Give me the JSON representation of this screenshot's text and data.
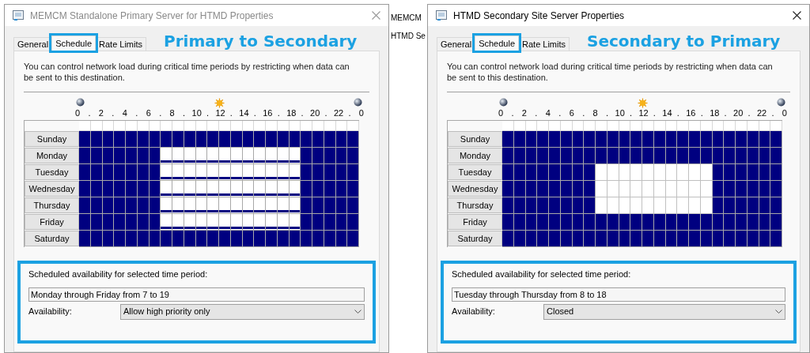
{
  "background_list": {
    "items": [
      "MEMCM",
      "HTMD Se"
    ]
  },
  "windows": [
    {
      "title": "MEMCM Standalone Primary Server for HTMD Properties",
      "active": false,
      "tabs": [
        {
          "label": "General",
          "selected": false,
          "highlight": false
        },
        {
          "label": "Schedule",
          "selected": true,
          "highlight": true
        },
        {
          "label": "Rate Limits",
          "selected": false,
          "highlight": false
        }
      ],
      "annotation": "Primary to Secondary",
      "description": "You can control network load during critical time periods by restricting when data can be sent to this destination.",
      "hours": [
        "0",
        ".",
        "2",
        ".",
        "4",
        ".",
        "6",
        ".",
        "8",
        ".",
        "10",
        ".",
        "12",
        ".",
        "14",
        ".",
        "16",
        ".",
        "18",
        ".",
        "20",
        ".",
        "22",
        ".",
        "0"
      ],
      "days": [
        {
          "label": "Sunday",
          "slots": [
            {
              "kind": "open"
            },
            {
              "kind": "open"
            },
            {
              "kind": "open"
            },
            {
              "kind": "open"
            },
            {
              "kind": "open"
            },
            {
              "kind": "open"
            },
            {
              "kind": "open"
            },
            {
              "kind": "open"
            },
            {
              "kind": "open"
            },
            {
              "kind": "open"
            },
            {
              "kind": "open"
            },
            {
              "kind": "open"
            },
            {
              "kind": "open"
            },
            {
              "kind": "open"
            },
            {
              "kind": "open"
            },
            {
              "kind": "open"
            },
            {
              "kind": "open"
            },
            {
              "kind": "open"
            },
            {
              "kind": "open"
            },
            {
              "kind": "open"
            },
            {
              "kind": "open"
            },
            {
              "kind": "open"
            },
            {
              "kind": "open"
            },
            {
              "kind": "open"
            }
          ]
        },
        {
          "label": "Monday",
          "slots": [
            {
              "kind": "open"
            },
            {
              "kind": "open"
            },
            {
              "kind": "open"
            },
            {
              "kind": "open"
            },
            {
              "kind": "open"
            },
            {
              "kind": "open"
            },
            {
              "kind": "open"
            },
            {
              "kind": "high"
            },
            {
              "kind": "high"
            },
            {
              "kind": "high"
            },
            {
              "kind": "high"
            },
            {
              "kind": "high"
            },
            {
              "kind": "high"
            },
            {
              "kind": "high"
            },
            {
              "kind": "high"
            },
            {
              "kind": "high"
            },
            {
              "kind": "high"
            },
            {
              "kind": "high"
            },
            {
              "kind": "high"
            },
            {
              "kind": "open"
            },
            {
              "kind": "open"
            },
            {
              "kind": "open"
            },
            {
              "kind": "open"
            },
            {
              "kind": "open"
            }
          ]
        },
        {
          "label": "Tuesday",
          "slots": [
            {
              "kind": "open"
            },
            {
              "kind": "open"
            },
            {
              "kind": "open"
            },
            {
              "kind": "open"
            },
            {
              "kind": "open"
            },
            {
              "kind": "open"
            },
            {
              "kind": "open"
            },
            {
              "kind": "high"
            },
            {
              "kind": "high"
            },
            {
              "kind": "high"
            },
            {
              "kind": "high"
            },
            {
              "kind": "high"
            },
            {
              "kind": "high"
            },
            {
              "kind": "high"
            },
            {
              "kind": "high"
            },
            {
              "kind": "high"
            },
            {
              "kind": "high"
            },
            {
              "kind": "high"
            },
            {
              "kind": "high"
            },
            {
              "kind": "open"
            },
            {
              "kind": "open"
            },
            {
              "kind": "open"
            },
            {
              "kind": "open"
            },
            {
              "kind": "open"
            }
          ]
        },
        {
          "label": "Wednesday",
          "slots": [
            {
              "kind": "open"
            },
            {
              "kind": "open"
            },
            {
              "kind": "open"
            },
            {
              "kind": "open"
            },
            {
              "kind": "open"
            },
            {
              "kind": "open"
            },
            {
              "kind": "open"
            },
            {
              "kind": "high"
            },
            {
              "kind": "high"
            },
            {
              "kind": "high"
            },
            {
              "kind": "high"
            },
            {
              "kind": "high"
            },
            {
              "kind": "high"
            },
            {
              "kind": "high"
            },
            {
              "kind": "high"
            },
            {
              "kind": "high"
            },
            {
              "kind": "high"
            },
            {
              "kind": "high"
            },
            {
              "kind": "high"
            },
            {
              "kind": "open"
            },
            {
              "kind": "open"
            },
            {
              "kind": "open"
            },
            {
              "kind": "open"
            },
            {
              "kind": "open"
            }
          ]
        },
        {
          "label": "Thursday",
          "slots": [
            {
              "kind": "open"
            },
            {
              "kind": "open"
            },
            {
              "kind": "open"
            },
            {
              "kind": "open"
            },
            {
              "kind": "open"
            },
            {
              "kind": "open"
            },
            {
              "kind": "open"
            },
            {
              "kind": "high"
            },
            {
              "kind": "high"
            },
            {
              "kind": "high"
            },
            {
              "kind": "high"
            },
            {
              "kind": "high"
            },
            {
              "kind": "high"
            },
            {
              "kind": "high"
            },
            {
              "kind": "high"
            },
            {
              "kind": "high"
            },
            {
              "kind": "high"
            },
            {
              "kind": "high"
            },
            {
              "kind": "high"
            },
            {
              "kind": "open"
            },
            {
              "kind": "open"
            },
            {
              "kind": "open"
            },
            {
              "kind": "open"
            },
            {
              "kind": "open"
            }
          ]
        },
        {
          "label": "Friday",
          "slots": [
            {
              "kind": "open"
            },
            {
              "kind": "open"
            },
            {
              "kind": "open"
            },
            {
              "kind": "open"
            },
            {
              "kind": "open"
            },
            {
              "kind": "open"
            },
            {
              "kind": "open"
            },
            {
              "kind": "high"
            },
            {
              "kind": "high"
            },
            {
              "kind": "high"
            },
            {
              "kind": "high"
            },
            {
              "kind": "high"
            },
            {
              "kind": "high"
            },
            {
              "kind": "high"
            },
            {
              "kind": "high"
            },
            {
              "kind": "high"
            },
            {
              "kind": "high"
            },
            {
              "kind": "high"
            },
            {
              "kind": "high"
            },
            {
              "kind": "open"
            },
            {
              "kind": "open"
            },
            {
              "kind": "open"
            },
            {
              "kind": "open"
            },
            {
              "kind": "open"
            }
          ]
        },
        {
          "label": "Saturday",
          "slots": [
            {
              "kind": "open"
            },
            {
              "kind": "open"
            },
            {
              "kind": "open"
            },
            {
              "kind": "open"
            },
            {
              "kind": "open"
            },
            {
              "kind": "open"
            },
            {
              "kind": "open"
            },
            {
              "kind": "open"
            },
            {
              "kind": "open"
            },
            {
              "kind": "open"
            },
            {
              "kind": "open"
            },
            {
              "kind": "open"
            },
            {
              "kind": "open"
            },
            {
              "kind": "open"
            },
            {
              "kind": "open"
            },
            {
              "kind": "open"
            },
            {
              "kind": "open"
            },
            {
              "kind": "open"
            },
            {
              "kind": "open"
            },
            {
              "kind": "open"
            },
            {
              "kind": "open"
            },
            {
              "kind": "open"
            },
            {
              "kind": "open"
            },
            {
              "kind": "open"
            }
          ]
        }
      ],
      "availability": {
        "heading": "Scheduled availability for selected time period:",
        "period": "Monday through Friday from 7 to 19",
        "label": "Availability:",
        "value": "Allow high priority only"
      }
    },
    {
      "title": "HTMD Secondary Site Server Properties",
      "active": true,
      "tabs": [
        {
          "label": "General",
          "selected": false,
          "highlight": false
        },
        {
          "label": "Schedule",
          "selected": true,
          "highlight": true
        },
        {
          "label": "Rate Limits",
          "selected": false,
          "highlight": false
        }
      ],
      "annotation": "Secondary to Primary",
      "description": "You can control network load during critical time periods by restricting when data can be sent to this destination.",
      "hours": [
        "0",
        ".",
        "2",
        ".",
        "4",
        ".",
        "6",
        ".",
        "8",
        ".",
        "10",
        ".",
        "12",
        ".",
        "14",
        ".",
        "16",
        ".",
        "18",
        ".",
        "20",
        ".",
        "22",
        ".",
        "0"
      ],
      "days": [
        {
          "label": "Sunday",
          "slots": [
            {
              "kind": "open"
            },
            {
              "kind": "open"
            },
            {
              "kind": "open"
            },
            {
              "kind": "open"
            },
            {
              "kind": "open"
            },
            {
              "kind": "open"
            },
            {
              "kind": "open"
            },
            {
              "kind": "open"
            },
            {
              "kind": "open"
            },
            {
              "kind": "open"
            },
            {
              "kind": "open"
            },
            {
              "kind": "open"
            },
            {
              "kind": "open"
            },
            {
              "kind": "open"
            },
            {
              "kind": "open"
            },
            {
              "kind": "open"
            },
            {
              "kind": "open"
            },
            {
              "kind": "open"
            },
            {
              "kind": "open"
            },
            {
              "kind": "open"
            },
            {
              "kind": "open"
            },
            {
              "kind": "open"
            },
            {
              "kind": "open"
            },
            {
              "kind": "open"
            }
          ]
        },
        {
          "label": "Monday",
          "slots": [
            {
              "kind": "open"
            },
            {
              "kind": "open"
            },
            {
              "kind": "open"
            },
            {
              "kind": "open"
            },
            {
              "kind": "open"
            },
            {
              "kind": "open"
            },
            {
              "kind": "open"
            },
            {
              "kind": "open"
            },
            {
              "kind": "open"
            },
            {
              "kind": "open"
            },
            {
              "kind": "open"
            },
            {
              "kind": "open"
            },
            {
              "kind": "open"
            },
            {
              "kind": "open"
            },
            {
              "kind": "open"
            },
            {
              "kind": "open"
            },
            {
              "kind": "open"
            },
            {
              "kind": "open"
            },
            {
              "kind": "open"
            },
            {
              "kind": "open"
            },
            {
              "kind": "open"
            },
            {
              "kind": "open"
            },
            {
              "kind": "open"
            },
            {
              "kind": "open"
            }
          ]
        },
        {
          "label": "Tuesday",
          "slots": [
            {
              "kind": "open"
            },
            {
              "kind": "open"
            },
            {
              "kind": "open"
            },
            {
              "kind": "open"
            },
            {
              "kind": "open"
            },
            {
              "kind": "open"
            },
            {
              "kind": "open"
            },
            {
              "kind": "open"
            },
            {
              "kind": "closed"
            },
            {
              "kind": "closed"
            },
            {
              "kind": "closed"
            },
            {
              "kind": "closed"
            },
            {
              "kind": "closed"
            },
            {
              "kind": "closed"
            },
            {
              "kind": "closed"
            },
            {
              "kind": "closed"
            },
            {
              "kind": "closed"
            },
            {
              "kind": "closed"
            },
            {
              "kind": "open"
            },
            {
              "kind": "open"
            },
            {
              "kind": "open"
            },
            {
              "kind": "open"
            },
            {
              "kind": "open"
            },
            {
              "kind": "open"
            }
          ]
        },
        {
          "label": "Wednesday",
          "slots": [
            {
              "kind": "open"
            },
            {
              "kind": "open"
            },
            {
              "kind": "open"
            },
            {
              "kind": "open"
            },
            {
              "kind": "open"
            },
            {
              "kind": "open"
            },
            {
              "kind": "open"
            },
            {
              "kind": "open"
            },
            {
              "kind": "closed"
            },
            {
              "kind": "closed"
            },
            {
              "kind": "closed"
            },
            {
              "kind": "closed"
            },
            {
              "kind": "closed"
            },
            {
              "kind": "closed"
            },
            {
              "kind": "closed"
            },
            {
              "kind": "closed"
            },
            {
              "kind": "closed"
            },
            {
              "kind": "closed"
            },
            {
              "kind": "open"
            },
            {
              "kind": "open"
            },
            {
              "kind": "open"
            },
            {
              "kind": "open"
            },
            {
              "kind": "open"
            },
            {
              "kind": "open"
            }
          ]
        },
        {
          "label": "Thursday",
          "slots": [
            {
              "kind": "open"
            },
            {
              "kind": "open"
            },
            {
              "kind": "open"
            },
            {
              "kind": "open"
            },
            {
              "kind": "open"
            },
            {
              "kind": "open"
            },
            {
              "kind": "open"
            },
            {
              "kind": "open"
            },
            {
              "kind": "closed"
            },
            {
              "kind": "closed"
            },
            {
              "kind": "closed"
            },
            {
              "kind": "closed"
            },
            {
              "kind": "closed"
            },
            {
              "kind": "closed"
            },
            {
              "kind": "closed"
            },
            {
              "kind": "closed"
            },
            {
              "kind": "closed"
            },
            {
              "kind": "closed"
            },
            {
              "kind": "open"
            },
            {
              "kind": "open"
            },
            {
              "kind": "open"
            },
            {
              "kind": "open"
            },
            {
              "kind": "open"
            },
            {
              "kind": "open"
            }
          ]
        },
        {
          "label": "Friday",
          "slots": [
            {
              "kind": "open"
            },
            {
              "kind": "open"
            },
            {
              "kind": "open"
            },
            {
              "kind": "open"
            },
            {
              "kind": "open"
            },
            {
              "kind": "open"
            },
            {
              "kind": "open"
            },
            {
              "kind": "open"
            },
            {
              "kind": "open"
            },
            {
              "kind": "open"
            },
            {
              "kind": "open"
            },
            {
              "kind": "open"
            },
            {
              "kind": "open"
            },
            {
              "kind": "open"
            },
            {
              "kind": "open"
            },
            {
              "kind": "open"
            },
            {
              "kind": "open"
            },
            {
              "kind": "open"
            },
            {
              "kind": "open"
            },
            {
              "kind": "open"
            },
            {
              "kind": "open"
            },
            {
              "kind": "open"
            },
            {
              "kind": "open"
            },
            {
              "kind": "open"
            }
          ]
        },
        {
          "label": "Saturday",
          "slots": [
            {
              "kind": "open"
            },
            {
              "kind": "open"
            },
            {
              "kind": "open"
            },
            {
              "kind": "open"
            },
            {
              "kind": "open"
            },
            {
              "kind": "open"
            },
            {
              "kind": "open"
            },
            {
              "kind": "open"
            },
            {
              "kind": "open"
            },
            {
              "kind": "open"
            },
            {
              "kind": "open"
            },
            {
              "kind": "open"
            },
            {
              "kind": "open"
            },
            {
              "kind": "open"
            },
            {
              "kind": "open"
            },
            {
              "kind": "open"
            },
            {
              "kind": "open"
            },
            {
              "kind": "open"
            },
            {
              "kind": "open"
            },
            {
              "kind": "open"
            },
            {
              "kind": "open"
            },
            {
              "kind": "open"
            },
            {
              "kind": "open"
            },
            {
              "kind": "open"
            }
          ]
        }
      ],
      "availability": {
        "heading": "Scheduled availability for selected time period:",
        "period": "Tuesday through Thursday from 8 to 18",
        "label": "Availability:",
        "value": "Closed"
      }
    }
  ]
}
